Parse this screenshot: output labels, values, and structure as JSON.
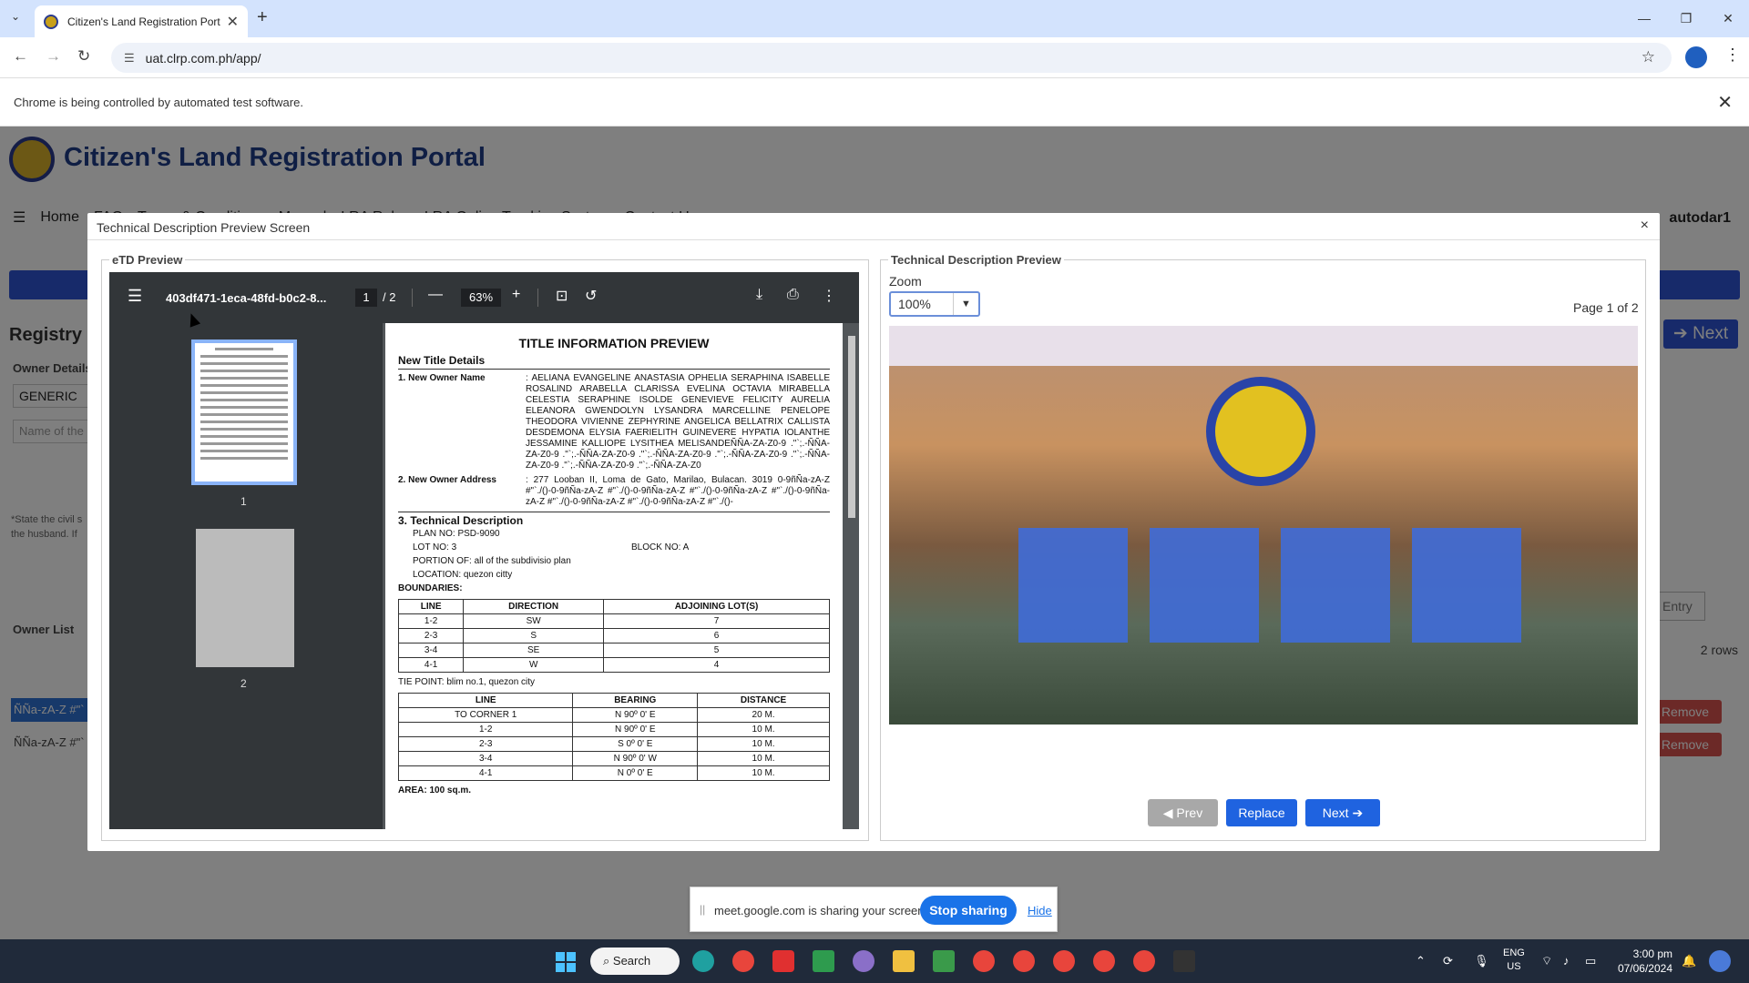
{
  "browser": {
    "tab_title": "Citizen's Land Registration Port",
    "url": "uat.clrp.com.ph/app/",
    "info_message": "Chrome is being controlled by automated test software."
  },
  "portal": {
    "title": "Citizen's Land Registration Portal",
    "menu": [
      "Home",
      "FAQ",
      "Terms & Conditions",
      "Manual",
      "LRA Rules",
      "LRA Online Tracking System",
      "Contact Us"
    ],
    "user": "autodar1",
    "page_title": "Registry",
    "owner_details_label": "Owner Details",
    "owner_type": "GENERIC",
    "name_placeholder": "Name of the",
    "note": "*State the civil s the husband. If",
    "next": "Next",
    "add_entry": "Add Entry",
    "owner_list_label": "Owner List",
    "rows_count": "2 rows",
    "row_text": "ÑÑa-zA-Z #\"`",
    "remove": "Remove"
  },
  "modal": {
    "title": "Technical Description Preview Screen",
    "left_legend": "eTD Preview",
    "right_legend": "Technical Description Preview",
    "zoom_label": "Zoom",
    "zoom_value": "100%",
    "page_indicator": "Page 1 of 2",
    "buttons": {
      "prev": "Prev",
      "replace": "Replace",
      "next": "Next"
    }
  },
  "pdf_viewer": {
    "filename": "403df471-1eca-48fd-b0c2-8...",
    "current_page": "1",
    "total_pages": "/ 2",
    "zoom": "63%",
    "thumb_labels": [
      "1",
      "2"
    ]
  },
  "pdf_content": {
    "heading": "TITLE INFORMATION PREVIEW",
    "section_title": "New Title Details",
    "owner_name_label": "1. New Owner Name",
    "owner_name_value": ": AELIANA EVANGELINE ANASTASIA OPHELIA SERAPHINA ISABELLE ROSALIND ARABELLA CLARISSA EVELINA OCTAVIA MIRABELLA CELESTIA SERAPHINE ISOLDE GENEVIEVE FELICITY AURELIA ELEANORA GWENDOLYN LYSANDRA MARCELLINE PENELOPE THEODORA VIVIENNE ZEPHYRINE ANGELICA BELLATRIX CALLISTA DESDEMONA ELYSIA FAERIELITH GUINEVERE HYPATIA IOLANTHE JESSAMINE KALLIOPE LYSITHEA MELISANDEÑÑA-ZA-Z0-9 .\"`;.-ÑÑA-ZA-Z0-9 .\"`;.-ÑÑA-ZA-Z0-9 .\"`;.-ÑÑA-ZA-Z0-9 .\"`;.-ÑÑA-ZA-Z0-9 .\"`;.-ÑÑA-ZA-Z0-9 .\"`;.-ÑÑA-ZA-Z0-9 .\"`;.-ÑÑA-ZA-Z0",
    "owner_address_label": "2. New Owner Address",
    "owner_address_value": ": 277 Looban II, Loma de Gato, Marilao, Bulacan. 3019 0-9ñÑa-zA-Z #\"`./()-0-9ñÑa-zA-Z #\"`./()-0-9ñÑa-zA-Z #\"`./()-0-9ñÑa-zA-Z #\"`./()-0-9ñÑa-zA-Z #\"`./()-0-9ñÑa-zA-Z #\"`./()-0-9ñÑa-zA-Z #\"`./()-",
    "tech_title": "3. Technical Description",
    "plan_no": "PLAN NO: PSD-9090",
    "lot_no": "LOT NO: 3",
    "block_no": "BLOCK NO: A",
    "portion_of": "PORTION OF: all of the subdivisio plan",
    "location": "LOCATION: quezon citty",
    "boundaries_label": "BOUNDARIES:",
    "boundaries_headers": [
      "LINE",
      "DIRECTION",
      "ADJOINING LOT(S)"
    ],
    "boundaries": [
      [
        "1-2",
        "SW",
        "7"
      ],
      [
        "2-3",
        "S",
        "6"
      ],
      [
        "3-4",
        "SE",
        "5"
      ],
      [
        "4-1",
        "W",
        "4"
      ]
    ],
    "tie_point": "TIE POINT: blim no.1, quezon city",
    "bearing_headers": [
      "LINE",
      "BEARING",
      "DISTANCE"
    ],
    "bearings": [
      [
        "TO CORNER 1",
        "N 90º 0' E",
        "20 M."
      ],
      [
        "1-2",
        "N 90º 0' E",
        "10 M."
      ],
      [
        "2-3",
        "S 0º 0' E",
        "10 M."
      ],
      [
        "3-4",
        "N 90º 0' W",
        "10 M."
      ],
      [
        "4-1",
        "N 0º 0' E",
        "10 M."
      ]
    ],
    "area": "AREA: 100 sq.m."
  },
  "screen_share": {
    "message": "meet.google.com is sharing your screen.",
    "stop": "Stop sharing",
    "hide": "Hide"
  },
  "taskbar": {
    "search": "Search",
    "lang": [
      "ENG",
      "US"
    ],
    "time": "3:00 pm",
    "date": "07/06/2024"
  }
}
